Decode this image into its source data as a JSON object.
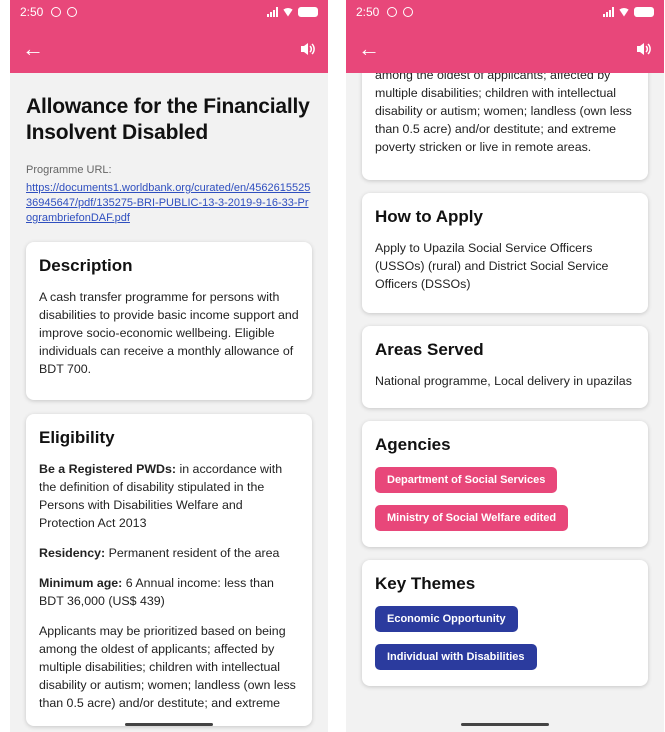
{
  "status": {
    "time": "2:50"
  },
  "left": {
    "title": "Allowance for the Financially Insolvent Disabled",
    "programme_url_label": "Programme URL:",
    "programme_url": "https://documents1.worldbank.org/curated/en/456261552536945647/pdf/135275-BRI-PUBLIC-13-3-2019-9-16-33-ProgrambriefonDAF.pdf",
    "description": {
      "heading": "Description",
      "text": "A cash transfer programme for persons with disabilities to provide basic income support and improve socio-economic wellbeing. Eligible individuals can receive a monthly allowance of BDT 700."
    },
    "eligibility": {
      "heading": "Eligibility",
      "registered_label": "Be a Registered PWDs:",
      "registered_text": " in accordance with the definition of disability stipulated in the Persons with Disabilities Welfare and Protection Act 2013",
      "residency_label": "Residency:",
      "residency_text": " Permanent resident of the area",
      "min_age_label": "Minimum age:",
      "min_age_text": " 6 Annual income: less than BDT 36,000 (US$ 439)",
      "priority_text": "Applicants may be prioritized based on being among the oldest of applicants; affected by multiple disabilities; children with intellectual disability or autism; women; landless (own less than 0.5 acre) and/or destitute; and extreme"
    }
  },
  "right": {
    "eligibility_tail": "among the oldest of applicants; affected by multiple disabilities; children with intellectual disability or autism; women; landless (own less than 0.5 acre) and/or destitute; and extreme poverty stricken or live in remote areas.",
    "how_to_apply": {
      "heading": "How to Apply",
      "text": "Apply to Upazila Social Service Officers (USSOs) (rural) and District Social Service Officers (DSSOs)"
    },
    "areas_served": {
      "heading": "Areas Served",
      "text": "National programme, Local delivery in upazilas"
    },
    "agencies": {
      "heading": "Agencies",
      "items": [
        "Department of Social Services",
        "Ministry of Social Welfare edited"
      ]
    },
    "key_themes": {
      "heading": "Key Themes",
      "items": [
        "Economic Opportunity",
        "Individual with Disabilities"
      ]
    }
  },
  "colors": {
    "accent": "#e8477a",
    "theme_chip": "#2b3b9e",
    "link": "#2f4fbf"
  },
  "icons": {
    "back": "arrow-left-icon",
    "speaker": "speaker-icon"
  }
}
